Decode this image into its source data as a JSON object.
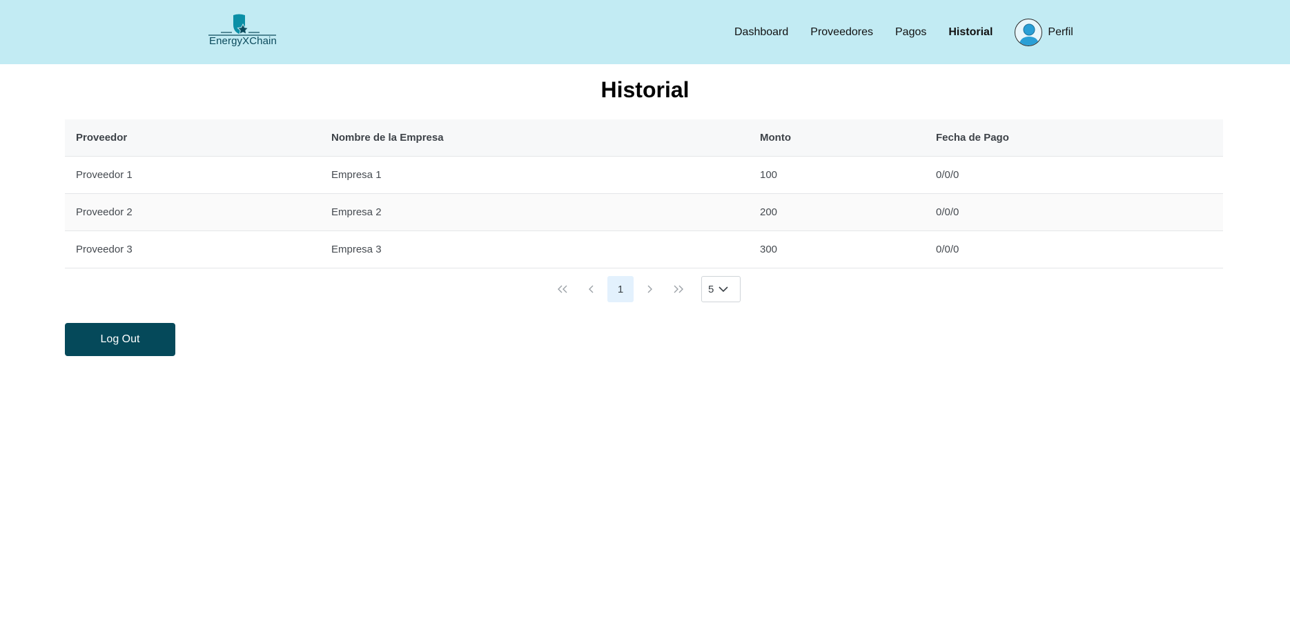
{
  "brand": {
    "name": "EnergyXChain"
  },
  "nav": {
    "items": [
      {
        "label": "Dashboard",
        "active": false
      },
      {
        "label": "Proveedores",
        "active": false
      },
      {
        "label": "Pagos",
        "active": false
      },
      {
        "label": "Historial",
        "active": true
      }
    ],
    "profile_label": "Perfil"
  },
  "page": {
    "title": "Historial"
  },
  "table": {
    "columns": [
      "Proveedor",
      "Nombre de la Empresa",
      "Monto",
      "Fecha de Pago"
    ],
    "rows": [
      [
        "Proveedor 1",
        "Empresa 1",
        "100",
        "0/0/0"
      ],
      [
        "Proveedor 2",
        "Empresa 2",
        "200",
        "0/0/0"
      ],
      [
        "Proveedor 3",
        "Empresa 3",
        "300",
        "0/0/0"
      ]
    ]
  },
  "pagination": {
    "first_icon": "double-chevron-left-icon",
    "prev_icon": "chevron-left-icon",
    "next_icon": "chevron-right-icon",
    "last_icon": "double-chevron-right-icon",
    "current_page": "1",
    "page_size": "5"
  },
  "actions": {
    "logout_label": "Log Out"
  },
  "colors": {
    "header_bg": "#c2ebf3",
    "brand_teal": "#0b8fa6",
    "logout_bg": "#05495a",
    "active_page_bg": "#e3f1fd"
  }
}
